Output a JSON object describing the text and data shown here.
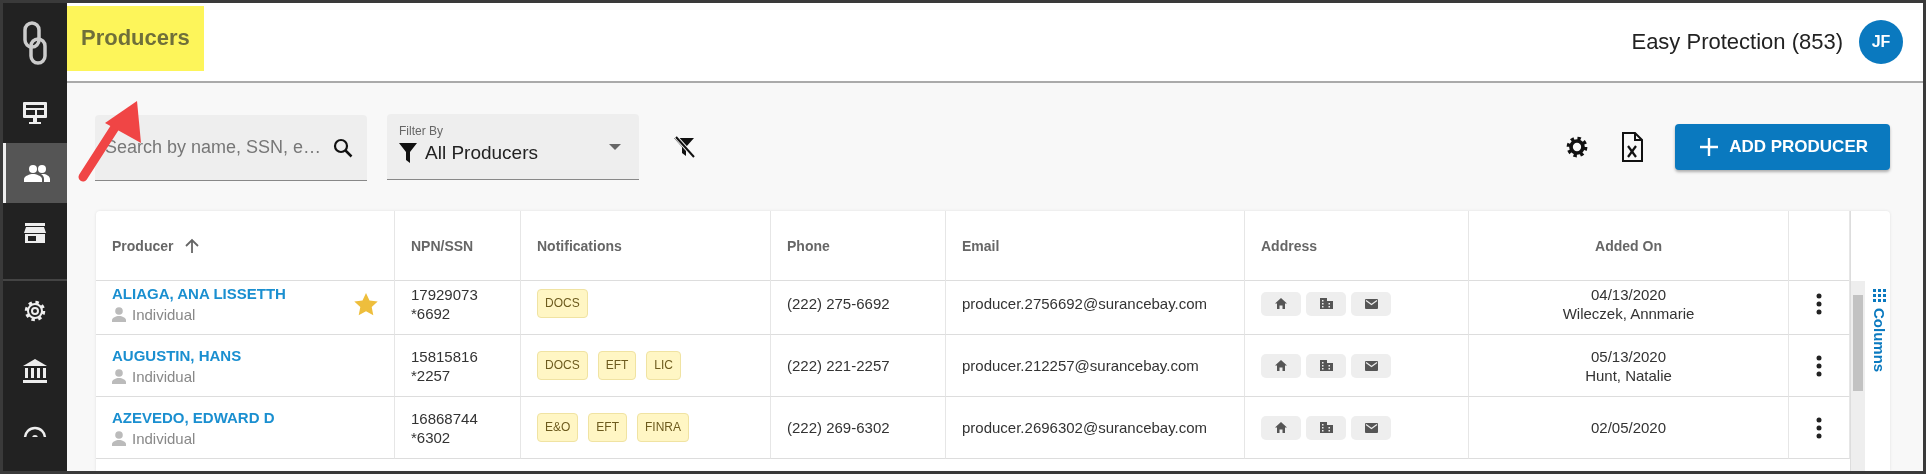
{
  "sidebar": {
    "items": [
      {
        "selected": false
      },
      {
        "selected": true
      },
      {
        "selected": false
      },
      {
        "selected": false
      },
      {
        "selected": false
      },
      {
        "selected": false
      }
    ]
  },
  "header": {
    "title": "Producers",
    "highlighted": true,
    "account": "Easy Protection (853)",
    "avatar": "JF"
  },
  "toolbar": {
    "search": {
      "placeholder": "Search by name, SSN, e…"
    },
    "filter": {
      "label": "Filter By",
      "value": "All Producers"
    },
    "add_button": "ADD PRODUCER"
  },
  "table": {
    "columns": [
      {
        "label": "Producer",
        "sorted": true
      },
      {
        "label": "NPN/SSN",
        "sorted": false
      },
      {
        "label": "Notifications",
        "sorted": false
      },
      {
        "label": "Phone",
        "sorted": false
      },
      {
        "label": "Email",
        "sorted": false
      },
      {
        "label": "Address",
        "sorted": false
      },
      {
        "label": "Added On",
        "sorted": false
      }
    ],
    "rows": [
      {
        "name": "ALIAGA, ANA LISSETTH",
        "type": "Individual",
        "starred": true,
        "npn": "17929073",
        "ssn": "*6692",
        "notifications": [
          "DOCS"
        ],
        "phone": "(222) 275-6692",
        "email": "producer.2756692@surancebay.com",
        "added_on": "04/13/2020",
        "added_by": "Wileczek, Annmarie"
      },
      {
        "name": "AUGUSTIN, HANS",
        "type": "Individual",
        "starred": false,
        "npn": "15815816",
        "ssn": "*2257",
        "notifications": [
          "DOCS",
          "EFT",
          "LIC"
        ],
        "phone": "(222) 221-2257",
        "email": "producer.212257@surancebay.com",
        "added_on": "05/13/2020",
        "added_by": "Hunt, Natalie"
      },
      {
        "name": "AZEVEDO, EDWARD D",
        "type": "Individual",
        "starred": false,
        "npn": "16868744",
        "ssn": "*6302",
        "notifications": [
          "E&O",
          "EFT",
          "FINRA"
        ],
        "phone": "(222) 269-6302",
        "email": "producer.2696302@surancebay.com",
        "added_on": "02/05/2020"
      }
    ],
    "columns_panel": "Columns"
  }
}
